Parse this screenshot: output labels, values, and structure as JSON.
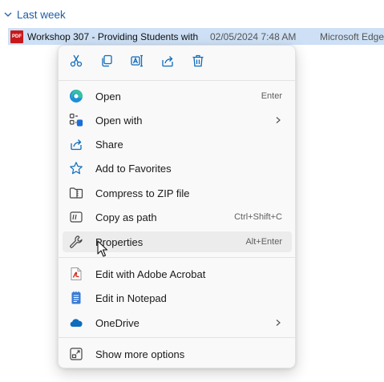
{
  "group": {
    "label": "Last week",
    "chevron_icon": "chevron-down-icon"
  },
  "file": {
    "icon": "pdf-icon",
    "icon_text": "PDF",
    "name": "Workshop 307 - Providing Students with ...",
    "date": "02/05/2024 7:48 AM",
    "type": "Microsoft Edge"
  },
  "quick_actions": [
    {
      "name": "cut-icon"
    },
    {
      "name": "copy-icon"
    },
    {
      "name": "rename-icon"
    },
    {
      "name": "share-icon"
    },
    {
      "name": "delete-icon"
    }
  ],
  "menu": {
    "items": [
      {
        "label": "Open",
        "shortcut": "Enter",
        "icon": "edge-icon"
      },
      {
        "label": "Open with",
        "shortcut": "",
        "icon": "open-with-icon",
        "submenu": true
      },
      {
        "label": "Share",
        "shortcut": "",
        "icon": "share-icon"
      },
      {
        "label": "Add to Favorites",
        "shortcut": "",
        "icon": "star-icon"
      },
      {
        "label": "Compress to ZIP file",
        "shortcut": "",
        "icon": "zip-folder-icon"
      },
      {
        "label": "Copy as path",
        "shortcut": "Ctrl+Shift+C",
        "icon": "copy-path-icon"
      },
      {
        "label": "Properties",
        "shortcut": "Alt+Enter",
        "icon": "wrench-icon",
        "hovered": true
      },
      {
        "label": "Edit with Adobe Acrobat",
        "shortcut": "",
        "icon": "acrobat-icon"
      },
      {
        "label": "Edit in Notepad",
        "shortcut": "",
        "icon": "notepad-icon"
      },
      {
        "label": "OneDrive",
        "shortcut": "",
        "icon": "onedrive-icon",
        "submenu": true
      },
      {
        "label": "Show more options",
        "shortcut": "",
        "icon": "more-options-icon"
      }
    ]
  },
  "colors": {
    "accent_blue": "#1f5fa8",
    "selection": "#cde0f5",
    "menu_bg": "#f9f9f9",
    "hover_bg": "#ececec",
    "pdf_red": "#c8181b",
    "onedrive_blue": "#0f6cbd"
  }
}
